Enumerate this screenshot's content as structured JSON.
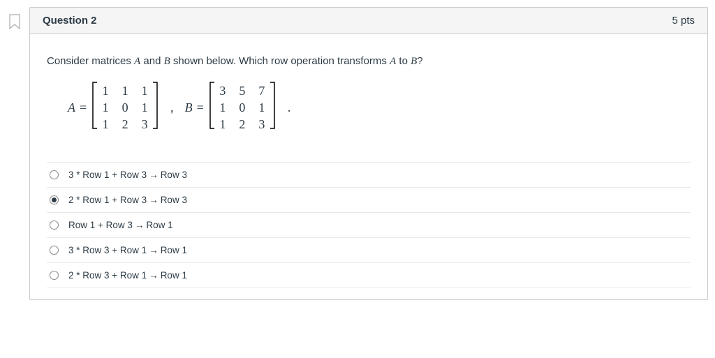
{
  "header": {
    "title": "Question 2",
    "points_label": "5 pts"
  },
  "stem": {
    "prefix": "Consider matrices ",
    "var1": "A",
    "mid1": " and ",
    "var2": "B",
    "mid2": " shown below.  Which row operation transforms ",
    "var3": "A",
    "mid3": " to ",
    "var4": "B",
    "suffix": "?"
  },
  "equation": {
    "A_label": "A",
    "eq": "=",
    "A": [
      [
        "1",
        "1",
        "1"
      ],
      [
        "1",
        "0",
        "1"
      ],
      [
        "1",
        "2",
        "3"
      ]
    ],
    "comma": ",",
    "B_label": "B",
    "B": [
      [
        "3",
        "5",
        "7"
      ],
      [
        "1",
        "0",
        "1"
      ],
      [
        "1",
        "2",
        "3"
      ]
    ],
    "period": "."
  },
  "answers": [
    {
      "pre": "3 * Row 1 + Row 3",
      "post": "Row 3",
      "selected": false
    },
    {
      "pre": "2 * Row 1 + Row 3",
      "post": "Row 3",
      "selected": true
    },
    {
      "pre": "Row 1 + Row 3",
      "post": "Row 1",
      "selected": false
    },
    {
      "pre": "3 * Row 3 + Row 1",
      "post": "Row 1",
      "selected": false
    },
    {
      "pre": "2 * Row 3 + Row 1",
      "post": "Row 1",
      "selected": false
    }
  ]
}
